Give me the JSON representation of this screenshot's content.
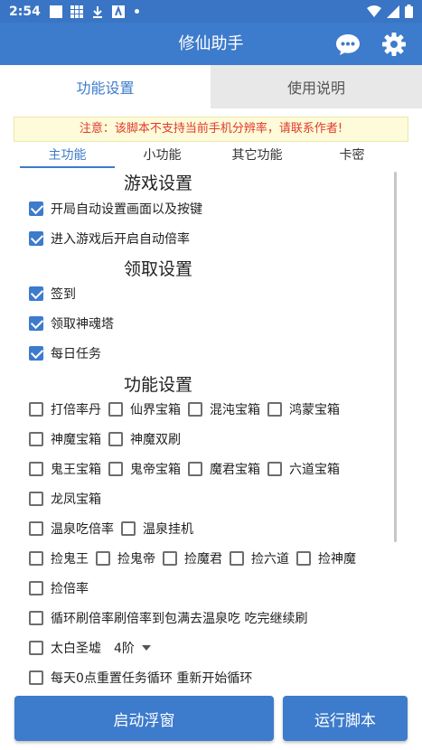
{
  "statusbar": {
    "time": "2:54"
  },
  "app": {
    "title": "修仙助手",
    "accent": "#3d7bcc"
  },
  "tabs": {
    "settings": "功能设置",
    "help": "使用说明"
  },
  "warning": "注意：该脚本不支持当前手机分辨率，请联系作者!",
  "subtabs": [
    "主功能",
    "小功能",
    "其它功能",
    "卡密"
  ],
  "sections": {
    "game": "游戏设置",
    "collect": "领取设置",
    "features": "功能设置"
  },
  "game_options": [
    {
      "label": "开局自动设置画面以及按键",
      "checked": true
    },
    {
      "label": "进入游戏后开启自动倍率",
      "checked": true
    }
  ],
  "collect_options": [
    {
      "label": "签到",
      "checked": true
    },
    {
      "label": "领取神魂塔",
      "checked": true
    },
    {
      "label": "每日任务",
      "checked": true
    }
  ],
  "feature_rows": [
    [
      "打倍率丹",
      "仙界宝箱",
      "混沌宝箱",
      "鸿蒙宝箱"
    ],
    [
      "神魔宝箱",
      "神魔双刷"
    ],
    [
      "鬼王宝箱",
      "鬼帝宝箱",
      "魔君宝箱",
      "六道宝箱"
    ],
    [
      "龙凤宝箱"
    ],
    [
      "温泉吃倍率",
      "温泉挂机"
    ],
    [
      "捡鬼王",
      "捡鬼帝",
      "捡魔君",
      "捡六道",
      "捡神魔"
    ],
    [
      "捡倍率"
    ],
    [
      "循环刷倍率刷倍率到包满去温泉吃 吃完继续刷"
    ],
    [
      "太白圣墟"
    ],
    [
      "每天0点重置任务循环 重新开始循环"
    ]
  ],
  "taibai_level": "4阶",
  "buttons": {
    "float": "启动浮窗",
    "run": "运行脚本"
  }
}
